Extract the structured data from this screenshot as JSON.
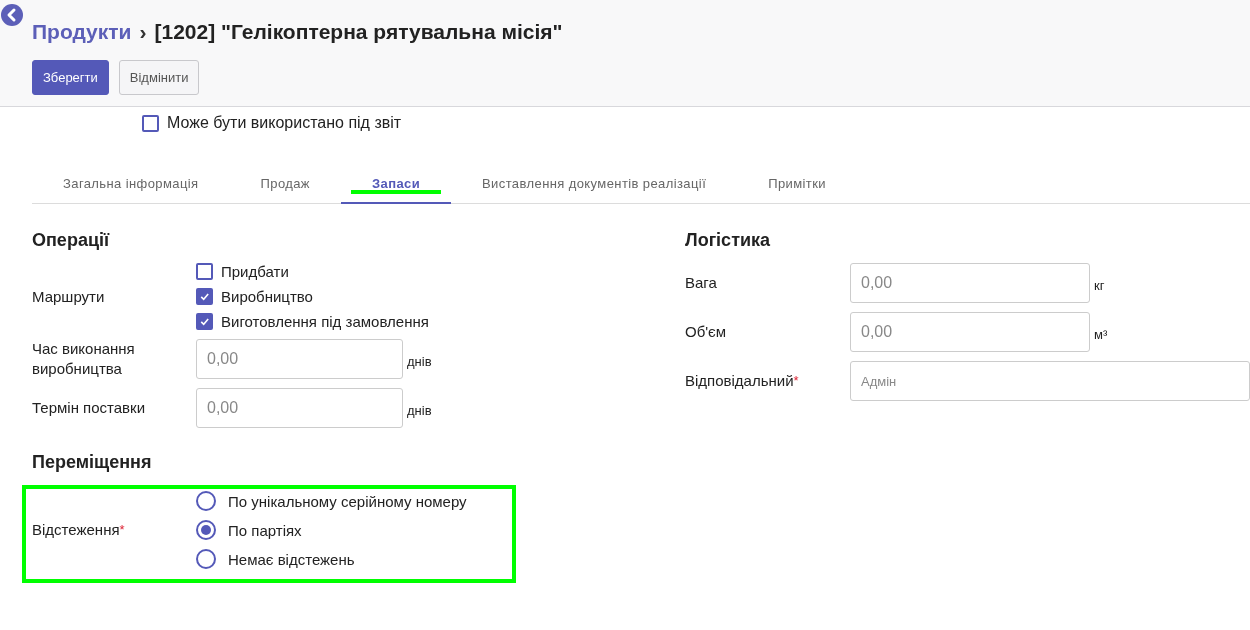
{
  "breadcrumb": {
    "parent": "Продукти",
    "separator": "›",
    "current": "[1202] \"Гелікоптерна рятувальна місія\""
  },
  "buttons": [
    {
      "label": "Зберегти",
      "kind": "primary"
    },
    {
      "label": "Відмінити",
      "kind": "secondary"
    }
  ],
  "report_checkbox": {
    "label": "Може бути використано під звіт",
    "checked": false
  },
  "tabs": [
    {
      "label": "Загальна інформація",
      "selected": false,
      "highlighted": false
    },
    {
      "label": "Продаж",
      "selected": false,
      "highlighted": false
    },
    {
      "label": "Запаси",
      "selected": true,
      "highlighted": true
    },
    {
      "label": "Виставлення документів реалізації",
      "selected": false,
      "highlighted": false
    },
    {
      "label": "Примітки",
      "selected": false,
      "highlighted": false
    }
  ],
  "operations": {
    "title": "Операції",
    "routes": {
      "label": "Маршрути",
      "options": [
        {
          "label": "Придбати",
          "checked": false
        },
        {
          "label": "Виробництво",
          "checked": true
        },
        {
          "label": "Виготовлення під замовлення",
          "checked": true
        }
      ]
    },
    "fields": [
      {
        "label": "Час виконання виробництва",
        "value": "0,00",
        "unit": "днів"
      },
      {
        "label": "Термін поставки",
        "value": "0,00",
        "unit": "днів"
      }
    ]
  },
  "moves": {
    "title": "Переміщення",
    "highlighted": true,
    "tracking": {
      "label": "Відстеження",
      "required_mark": "*",
      "options": [
        {
          "label": "По унікальному серійному номеру",
          "selected": false
        },
        {
          "label": "По партіях",
          "selected": true
        },
        {
          "label": "Немає відстежень",
          "selected": false
        }
      ]
    }
  },
  "logistics": {
    "title": "Логістика",
    "fields": [
      {
        "label": "Вага",
        "value": "0,00",
        "unit": "кг",
        "kind": "number"
      },
      {
        "label": "Об'єм",
        "value": "0,00",
        "unit": "м³",
        "kind": "number"
      },
      {
        "label": "Відповідальний",
        "required_mark": "*",
        "value": "Адмін",
        "kind": "select"
      }
    ]
  }
}
